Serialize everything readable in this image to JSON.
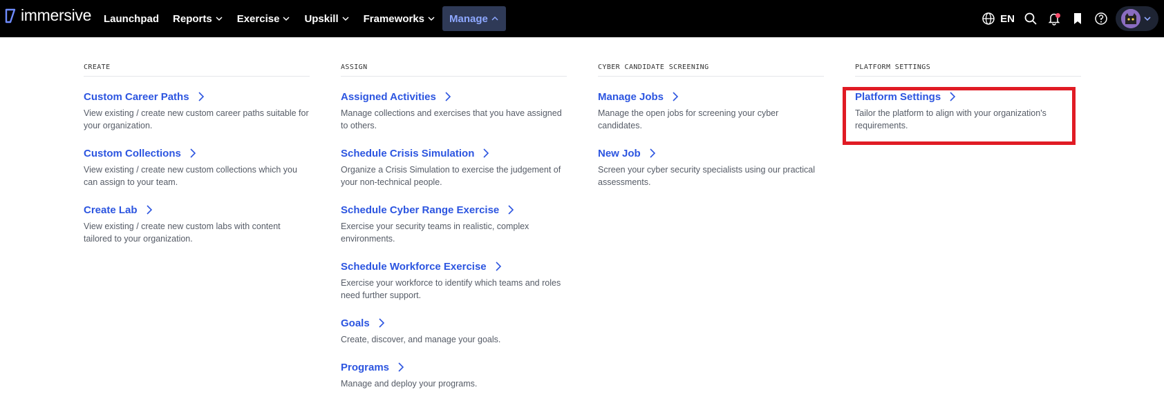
{
  "brand": {
    "name": "immersive"
  },
  "nav": [
    {
      "label": "Launchpad",
      "has_chevron": false,
      "active": false
    },
    {
      "label": "Reports",
      "has_chevron": true,
      "active": false
    },
    {
      "label": "Exercise",
      "has_chevron": true,
      "active": false
    },
    {
      "label": "Upskill",
      "has_chevron": true,
      "active": false
    },
    {
      "label": "Frameworks",
      "has_chevron": true,
      "active": false
    },
    {
      "label": "Manage",
      "has_chevron": true,
      "active": true
    }
  ],
  "toolbar": {
    "language": "EN",
    "icons": [
      "globe-icon",
      "search-icon",
      "bell-icon",
      "bookmark-icon",
      "help-icon",
      "avatar",
      "chevron-down-icon"
    ]
  },
  "colors": {
    "topbar": "#000000",
    "link": "#2c55e0",
    "active_bg": "#2f3a57",
    "active_text": "#8ea8ff",
    "highlight": "#e01b24"
  },
  "columns": [
    {
      "heading": "CREATE",
      "entries": [
        {
          "title": "Custom Career Paths",
          "desc": "View existing / create new custom career paths suitable for your organization."
        },
        {
          "title": "Custom Collections",
          "desc": "View existing / create new custom collections which you can assign to your team."
        },
        {
          "title": "Create Lab",
          "desc": "View existing / create new custom labs with content tailored to your organization."
        }
      ]
    },
    {
      "heading": "ASSIGN",
      "entries": [
        {
          "title": "Assigned Activities",
          "desc": "Manage collections and exercises that you have assigned to others."
        },
        {
          "title": "Schedule Crisis Simulation",
          "desc": "Organize a Crisis Simulation to exercise the judgement of your non-technical people."
        },
        {
          "title": "Schedule Cyber Range Exercise",
          "desc": "Exercise your security teams in realistic, complex environments."
        },
        {
          "title": "Schedule Workforce Exercise",
          "desc": "Exercise your workforce to identify which teams and roles need further support."
        },
        {
          "title": "Goals",
          "desc": "Create, discover, and manage your goals."
        },
        {
          "title": "Programs",
          "desc": "Manage and deploy your programs."
        }
      ]
    },
    {
      "heading": "CYBER CANDIDATE SCREENING",
      "entries": [
        {
          "title": "Manage Jobs",
          "desc": "Manage the open jobs for screening your cyber candidates."
        },
        {
          "title": "New Job",
          "desc": "Screen your cyber security specialists using our practical assessments."
        }
      ]
    },
    {
      "heading": "PLATFORM SETTINGS",
      "entries": [
        {
          "title": "Platform Settings",
          "desc": "Tailor the platform to align with your organization's requirements."
        }
      ]
    }
  ]
}
